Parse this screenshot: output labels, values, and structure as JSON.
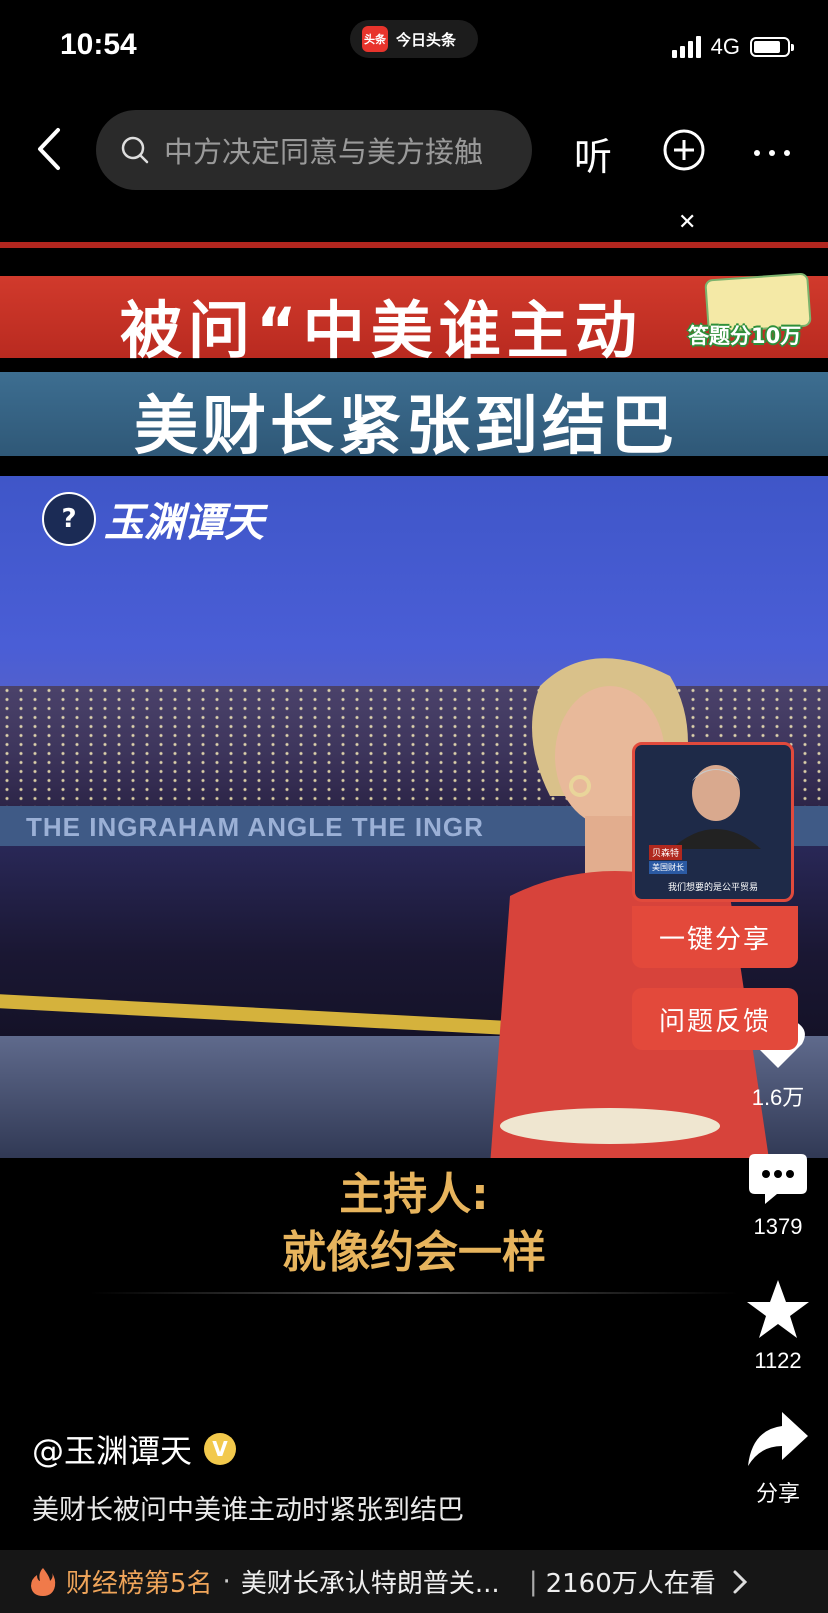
{
  "status_bar": {
    "time": "10:54",
    "app_name": "今日头条",
    "app_logo_text": "头条",
    "network": "4G"
  },
  "nav": {
    "search_placeholder": "中方决定同意与美方接触",
    "listen_label": "听"
  },
  "video": {
    "banner_red": "被问“中美谁主动",
    "banner_blue": "美财长紧张到结巴",
    "quiz_badge_label": "答题分10万",
    "channel_logo_text": "玉渊谭天",
    "studio_text": "THE INGRAHAM ANGLE   THE INGR",
    "caption_line1": "主持人:",
    "caption_line2": "就像约会一样"
  },
  "popup": {
    "thumb_name": "贝森特",
    "thumb_title": "美国财长",
    "thumb_subtitle": "我们想要的是公平贸易",
    "share_label": "一键分享",
    "feedback_label": "问题反馈"
  },
  "actions": {
    "like_count": "1.6万",
    "comment_count": "1379",
    "favorite_count": "1122",
    "share_label": "分享"
  },
  "author": {
    "name": "@玉渊谭天",
    "verified_mark": "V"
  },
  "video_title": "美财长被问中美谁主动时紧张到结巴",
  "hotbar": {
    "rank": "财经榜第5名",
    "dot": "·",
    "topic": "美财长承认特朗普关...",
    "separator": "|",
    "viewers": "2160万人在看"
  }
}
